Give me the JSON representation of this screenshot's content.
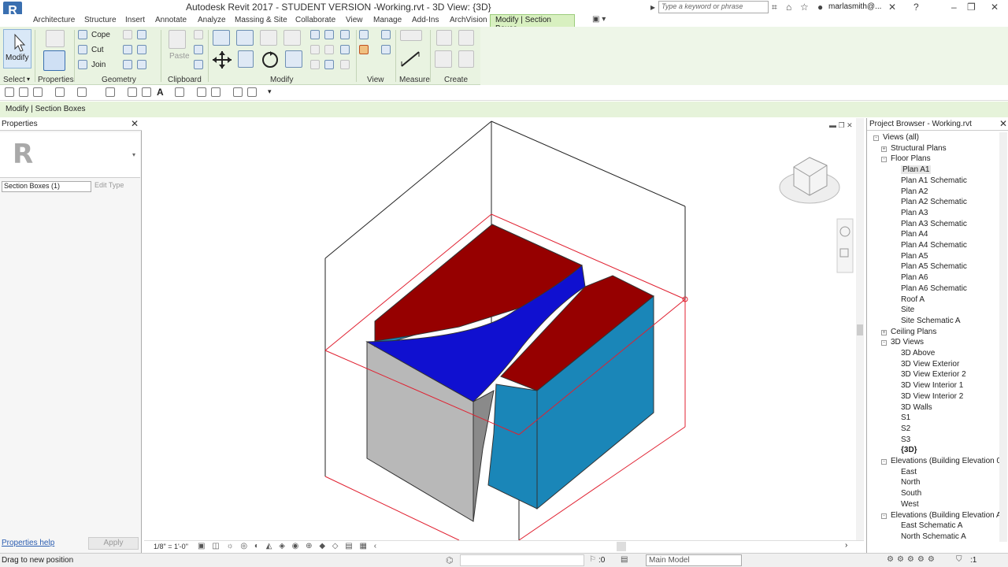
{
  "window": {
    "title": "Autodesk Revit 2017 - STUDENT VERSION -",
    "file": "Working.rvt - 3D View: {3D}",
    "search_placeholder": "Type a keyword or phrase",
    "user": "marlasmith@..."
  },
  "tabs": [
    "Architecture",
    "Structure",
    "Insert",
    "Annotate",
    "Analyze",
    "Massing & Site",
    "Collaborate",
    "View",
    "Manage",
    "Add-Ins",
    "ArchVision"
  ],
  "active_tab": "Modify | Section Boxes",
  "ribbon": {
    "modify_label": "Modify",
    "select_label": "Select",
    "properties_label": "Properties",
    "geometry_label": "Geometry",
    "clipboard_label": "Clipboard",
    "modify_panel_label": "Modify",
    "view_label": "View",
    "measure_label": "Measure",
    "create_label": "Create",
    "cope": "Cope",
    "cut": "Cut",
    "join": "Join",
    "paste": "Paste"
  },
  "context_bar": "Modify | Section Boxes",
  "properties": {
    "title": "Properties",
    "type_selector": "Section Boxes (1)",
    "edit_type": "Edit Type",
    "help_link": "Properties help",
    "apply": "Apply"
  },
  "viewport": {
    "scale": "1/8\" = 1'-0\""
  },
  "browser": {
    "title": "Project Browser - Working.rvt",
    "items": [
      {
        "label": "Views (all)",
        "level": 0,
        "toggle": "-"
      },
      {
        "label": "Structural Plans",
        "level": 1,
        "toggle": "+"
      },
      {
        "label": "Floor Plans",
        "level": 1,
        "toggle": "-"
      },
      {
        "label": "Plan A1",
        "level": 2,
        "selected": true
      },
      {
        "label": "Plan A1 Schematic",
        "level": 2
      },
      {
        "label": "Plan A2",
        "level": 2
      },
      {
        "label": "Plan A2 Schematic",
        "level": 2
      },
      {
        "label": "Plan A3",
        "level": 2
      },
      {
        "label": "Plan A3 Schematic",
        "level": 2
      },
      {
        "label": "Plan A4",
        "level": 2
      },
      {
        "label": "Plan A4 Schematic",
        "level": 2
      },
      {
        "label": "Plan A5",
        "level": 2
      },
      {
        "label": "Plan A5 Schematic",
        "level": 2
      },
      {
        "label": "Plan A6",
        "level": 2
      },
      {
        "label": "Plan A6 Schematic",
        "level": 2
      },
      {
        "label": "Roof A",
        "level": 2
      },
      {
        "label": "Site",
        "level": 2
      },
      {
        "label": "Site Schematic A",
        "level": 2
      },
      {
        "label": "Ceiling Plans",
        "level": 1,
        "toggle": "+"
      },
      {
        "label": "3D Views",
        "level": 1,
        "toggle": "-"
      },
      {
        "label": "3D Above",
        "level": 2
      },
      {
        "label": "3D View Exterior",
        "level": 2
      },
      {
        "label": "3D View Exterior 2",
        "level": 2
      },
      {
        "label": "3D View Interior 1",
        "level": 2
      },
      {
        "label": "3D View Interior 2",
        "level": 2
      },
      {
        "label": "3D Walls",
        "level": 2
      },
      {
        "label": "S1",
        "level": 2
      },
      {
        "label": "S2",
        "level": 2
      },
      {
        "label": "S3",
        "level": 2
      },
      {
        "label": "{3D}",
        "level": 2,
        "bold": true
      },
      {
        "label": "Elevations (Building Elevation 0",
        "level": 1,
        "toggle": "-"
      },
      {
        "label": "East",
        "level": 2
      },
      {
        "label": "North",
        "level": 2
      },
      {
        "label": "South",
        "level": 2
      },
      {
        "label": "West",
        "level": 2
      },
      {
        "label": "Elevations (Building Elevation A",
        "level": 1,
        "toggle": "-"
      },
      {
        "label": "East Schematic A",
        "level": 2
      },
      {
        "label": "North Schematic A",
        "level": 2
      }
    ]
  },
  "status": {
    "message": "Drag to new position",
    "selection_count": ":0",
    "model": "Main Model",
    "filter": ":1"
  },
  "colors": {
    "ribbon_bg": "#e9f3e1",
    "active_tab": "#d8f0c0",
    "roof_red": "#960000",
    "blue_surface": "#1010d0",
    "wall_blue": "#1a86b8",
    "wall_grey": "#b8b8b8",
    "section_box_red": "#e02030"
  }
}
